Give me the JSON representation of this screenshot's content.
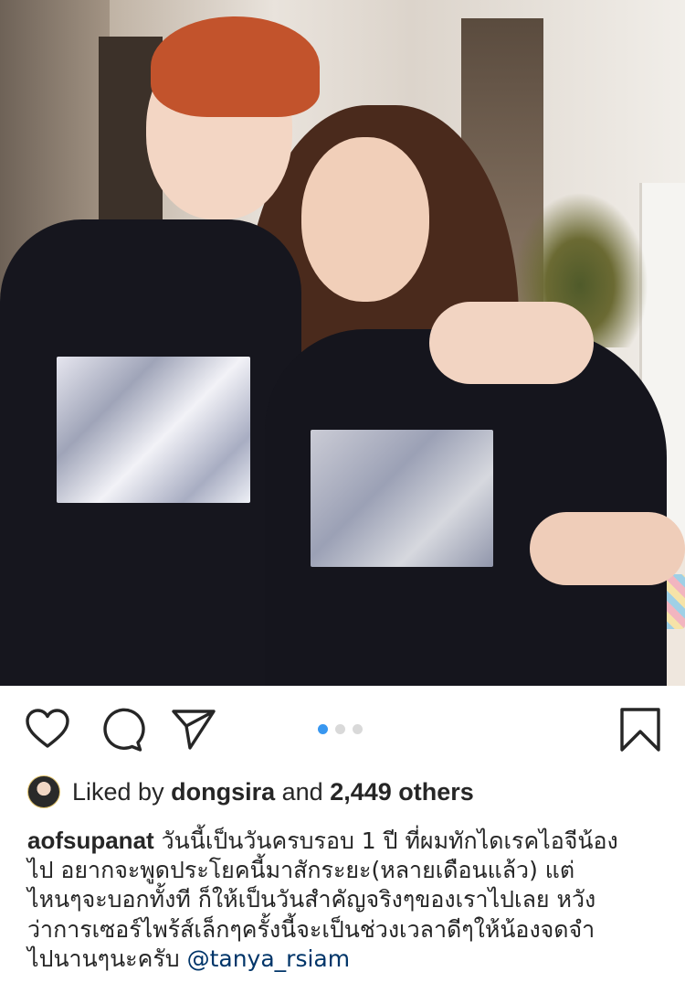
{
  "post": {
    "photo": {
      "description_icon": "photo"
    },
    "carousel": {
      "count": 3,
      "active_index": 0
    },
    "actions": {
      "like_icon": "heart-icon",
      "comment_icon": "comment-icon",
      "share_icon": "send-icon",
      "save_icon": "bookmark-icon"
    },
    "likes": {
      "prefix": "Liked by",
      "user": "dongsira",
      "middle": "and",
      "count": "2,449 others"
    },
    "caption": {
      "username": "aofsupanat",
      "line1": "วันนี้เป็นวันครบรอบ 1 ปี ที่ผมทักไดเรคไอจีน้อง",
      "line2": "ไป อยากจะพูดประโยคนี้มาสักระยะ(หลายเดือนแล้ว) แต่",
      "line3": "ไหนๆจะบอกทั้งที ก็ให้เป็นวันสำคัญจริงๆของเราไปเลย หวัง",
      "line4": "ว่าการเซอร์ไพร้ส์เล็กๆครั้งนี้จะเป็นช่วงเวลาดีๆให้น้องจดจำ",
      "line5": "ไปนานๆนะครับ",
      "mention": "@tanya_rsiam"
    },
    "colors": {
      "text": "#262626",
      "accent_dot": "#3897f0",
      "mention": "#003569"
    }
  }
}
